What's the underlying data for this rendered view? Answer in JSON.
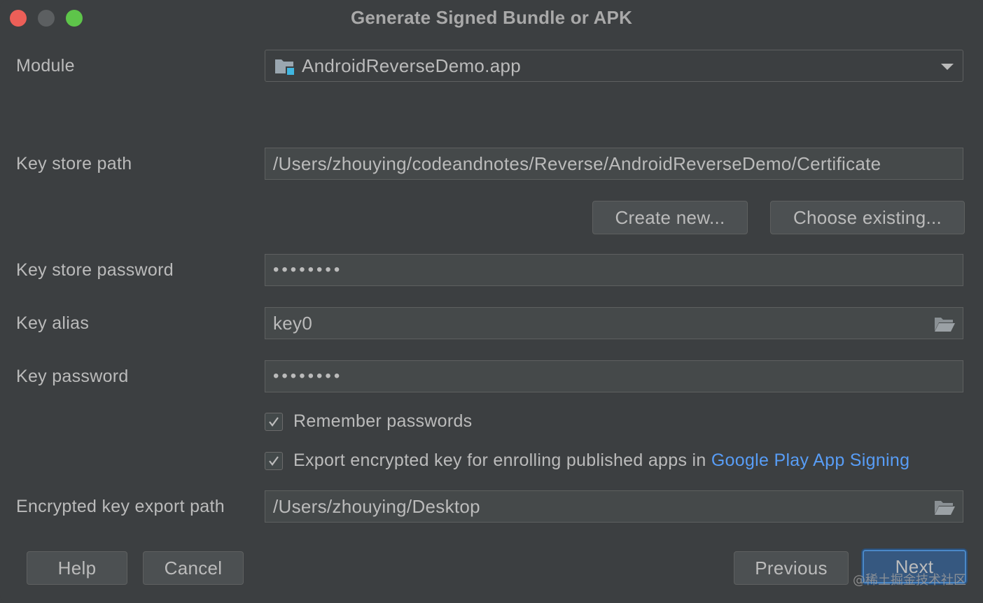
{
  "window": {
    "title": "Generate Signed Bundle or APK"
  },
  "form": {
    "module_label": "Module",
    "module_value": "AndroidReverseDemo.app",
    "keystore_path_label": "Key store path",
    "keystore_path_value": "/Users/zhouying/codeandnotes/Reverse/AndroidReverseDemo/Certificate",
    "create_new_label": "Create new...",
    "choose_existing_label": "Choose existing...",
    "keystore_password_label": "Key store password",
    "keystore_password_value": "••••••••",
    "key_alias_label": "Key alias",
    "key_alias_value": "key0",
    "key_password_label": "Key password",
    "key_password_value": "••••••••",
    "remember_passwords": {
      "label": "Remember passwords",
      "checked": true
    },
    "export_key": {
      "label": "Export encrypted key for enrolling published apps in",
      "link": "Google Play App Signing",
      "checked": true
    },
    "export_path_label": "Encrypted key export path",
    "export_path_value": "/Users/zhouying/Desktop"
  },
  "footer": {
    "help_label": "Help",
    "cancel_label": "Cancel",
    "previous_label": "Previous",
    "next_label": "Next"
  },
  "watermark": "@稀土掘金技术社区",
  "colors": {
    "background": "#3c3f41",
    "field_bg": "#45494a",
    "link": "#589df6",
    "default_button": "#365880"
  }
}
